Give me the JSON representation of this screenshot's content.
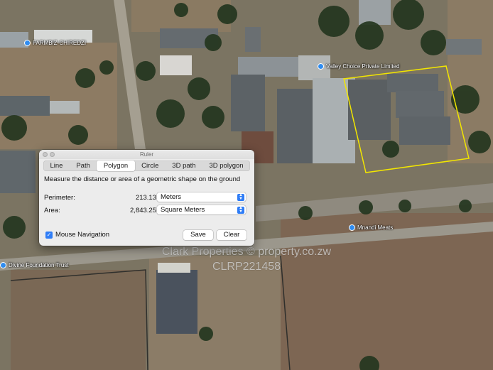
{
  "map": {
    "places": [
      {
        "name": "FARMBIZ-CHIREDZI"
      },
      {
        "name": "Valley Choice Private Limited"
      },
      {
        "name": "Mnandi Meats"
      },
      {
        "name": "Divine Foundation Trust"
      }
    ],
    "polygon_color": "#f2e600"
  },
  "watermark": {
    "line1": "Clark Properties © property.co.zw",
    "line2": "CLRP221458"
  },
  "ruler": {
    "title": "Ruler",
    "tabs": [
      "Line",
      "Path",
      "Polygon",
      "Circle",
      "3D path",
      "3D polygon"
    ],
    "active_tab": "Polygon",
    "description": "Measure the distance or area of a geometric shape on the ground",
    "perimeter": {
      "label": "Perimeter:",
      "value": "213.13",
      "unit": "Meters"
    },
    "area": {
      "label": "Area:",
      "value": "2,843.25",
      "unit": "Square Meters"
    },
    "mouse_navigation": {
      "label": "Mouse Navigation",
      "checked": true
    },
    "save_label": "Save",
    "clear_label": "Clear"
  }
}
